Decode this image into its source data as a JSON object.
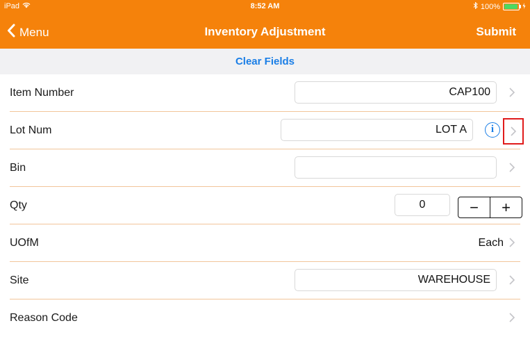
{
  "status": {
    "carrier": "iPad",
    "time": "8:52 AM",
    "battery": "100%",
    "battery_level": 1.0
  },
  "nav": {
    "back_label": "Menu",
    "title": "Inventory Adjustment",
    "submit_label": "Submit"
  },
  "clear_label": "Clear Fields",
  "rows": {
    "item_number": {
      "label": "Item Number",
      "value": "CAP100"
    },
    "lot_num": {
      "label": "Lot Num",
      "value": "LOT A",
      "info": "i"
    },
    "bin": {
      "label": "Bin",
      "value": ""
    },
    "qty": {
      "label": "Qty",
      "value": "0",
      "minus": "−",
      "plus": "+"
    },
    "uofm": {
      "label": "UOfM",
      "value": "Each"
    },
    "site": {
      "label": "Site",
      "value": "WAREHOUSE"
    },
    "reason_code": {
      "label": "Reason Code",
      "value": ""
    }
  },
  "colors": {
    "accent": "#f5820b",
    "link": "#1a7ee6",
    "highlight_box": "#e01b1b",
    "divider": "#f2c59a"
  },
  "icons": [
    "wifi-icon",
    "bluetooth-icon",
    "battery-icon",
    "chevron-left-icon",
    "chevron-right-icon",
    "info-icon"
  ]
}
